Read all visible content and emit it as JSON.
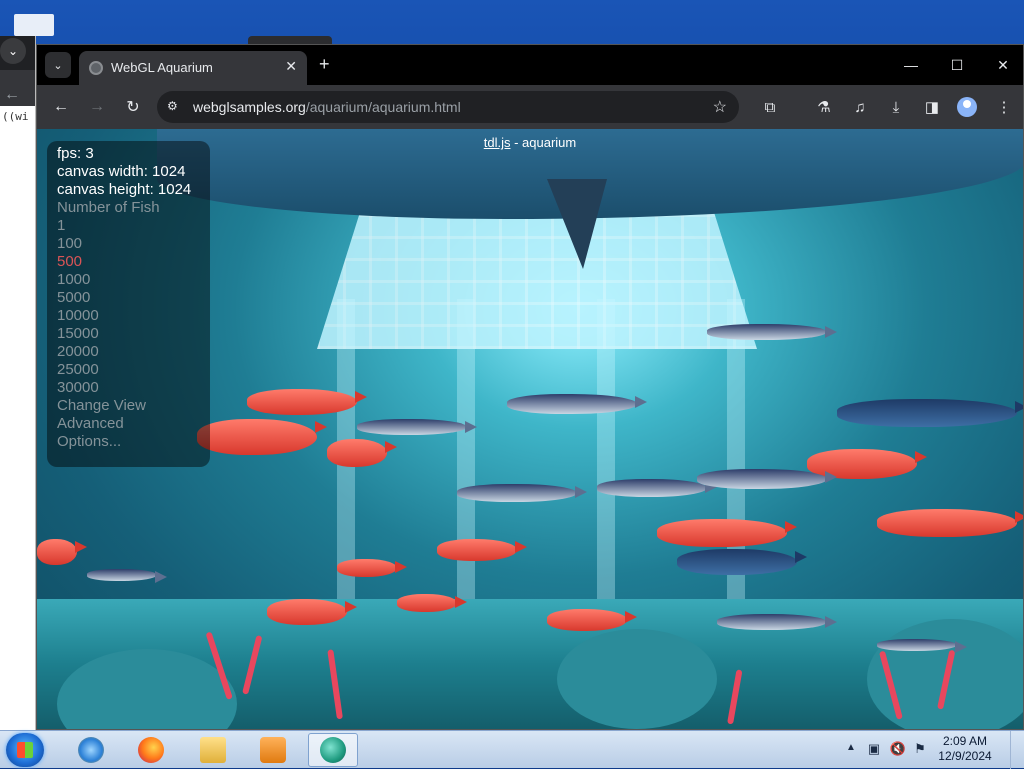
{
  "desktop": {
    "bg_window_code": "((wi"
  },
  "browser": {
    "tab": {
      "title": "WebGL Aquarium",
      "close": "✕"
    },
    "new_tab": "+",
    "window_controls": {
      "minimize": "—",
      "maximize": "☐",
      "close": "✕"
    },
    "toolbar": {
      "back": "←",
      "forward": "→",
      "reload": "↻",
      "url_host": "webglsamples.org",
      "url_path": "/aquarium/aquarium.html",
      "star": "☆"
    }
  },
  "page": {
    "title_lib": "tdl.js",
    "title_rest": " - aquarium",
    "hud": {
      "stats": [
        "fps: 3",
        "canvas width: 1024",
        "canvas height: 1024"
      ],
      "menu": [
        "Number of Fish",
        "1",
        "100",
        "500",
        "1000",
        "5000",
        "10000",
        "15000",
        "20000",
        "25000",
        "30000",
        "Change View",
        "Advanced",
        "Options..."
      ],
      "selected_index": 3
    }
  },
  "taskbar": {
    "apps": [
      "internet-explorer",
      "firefox",
      "file-explorer",
      "media-player",
      "chrome"
    ],
    "clock_time": "2:09 AM",
    "clock_date": "12/9/2024",
    "tray_arrow": "▲"
  },
  "colors": {
    "accent_selected": "#ff5a5a",
    "taskbar": "#c9d9ee"
  }
}
